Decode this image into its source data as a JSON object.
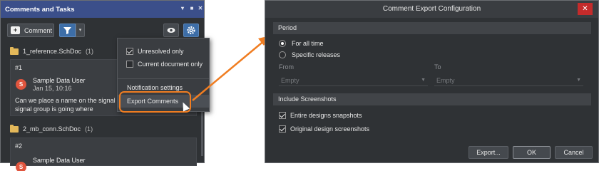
{
  "panel": {
    "title": "Comments and Tasks",
    "title_controls": [
      "▾",
      "■",
      "✕"
    ],
    "comment_button": "Comment",
    "comment_icon_glyph": "+",
    "filter_dropdown_glyph": "▾"
  },
  "menu": {
    "unresolved_only": "Unresolved only",
    "current_document_only": "Current document only",
    "notification_settings": "Notification settings",
    "export_comments": "Export Comments"
  },
  "list": {
    "documents": [
      {
        "name": "1_reference.SchDoc",
        "count": "(1)"
      },
      {
        "name": "2_mb_conn.SchDoc",
        "count": "(1)"
      }
    ],
    "cards": [
      {
        "number": "#1",
        "avatar": "S",
        "user": "Sample Data User",
        "date": "Jan 15, 10:16",
        "line1": "Can we place a name on the signal har",
        "line2": "signal group is going where"
      },
      {
        "number": "#2",
        "avatar": "S",
        "user": "Sample Data User"
      }
    ]
  },
  "dialog": {
    "title": "Comment Export Configuration",
    "close_glyph": "✕",
    "period_section": "Period",
    "for_all_time": "For all time",
    "specific_releases": "Specific releases",
    "from_label": "From",
    "to_label": "To",
    "from_placeholder": "Empty",
    "to_placeholder": "Empty",
    "screenshots_section": "Include Screenshots",
    "entire_designs": "Entire designs snapshots",
    "original_screenshots": "Original design screenshots",
    "export_button": "Export...",
    "ok_button": "OK",
    "cancel_button": "Cancel"
  },
  "colors": {
    "accent_orange": "#f07d21",
    "title_bar_blue": "#3b4f8a",
    "button_blue": "#3d6ea8",
    "avatar_red": "#e0553e",
    "close_red": "#c42b2b"
  },
  "icons": [
    "plus-icon",
    "filter-icon",
    "eye-icon",
    "gear-icon",
    "folder-icon",
    "cursor-icon",
    "close-icon",
    "chevron-down-icon"
  ]
}
